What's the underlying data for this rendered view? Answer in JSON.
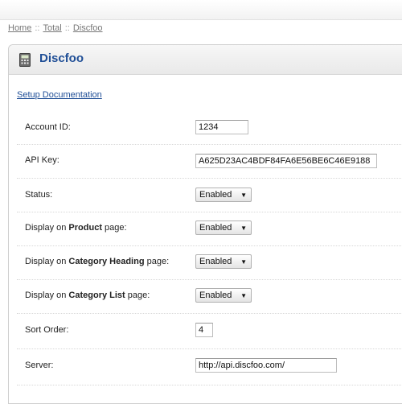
{
  "breadcrumb": {
    "home": "Home",
    "total": "Total",
    "current": "Discfoo",
    "separator": "::"
  },
  "panel": {
    "title": "Discfoo",
    "setup_link": "Setup Documentation"
  },
  "fields": {
    "account_id": {
      "label": "Account ID:",
      "value": "1234"
    },
    "api_key": {
      "label": "API Key:",
      "value": "A625D23AC4BDF84FA6E56BE6C46E9188"
    },
    "status": {
      "label": "Status:",
      "value": "Enabled"
    },
    "product_page": {
      "label_pre": "Display on ",
      "label_bold": "Product",
      "label_post": " page:",
      "value": "Enabled"
    },
    "category_heading": {
      "label_pre": "Display on ",
      "label_bold": "Category Heading",
      "label_post": " page:",
      "value": "Enabled"
    },
    "category_list": {
      "label_pre": "Display on ",
      "label_bold": "Category List",
      "label_post": " page:",
      "value": "Enabled"
    },
    "sort_order": {
      "label": "Sort Order:",
      "value": "4"
    },
    "server": {
      "label": "Server:",
      "value": "http://api.discfoo.com/"
    }
  },
  "icons": {
    "panel_icon": "calculator-icon",
    "select_arrow": "dropdown-arrow-icon"
  },
  "colors": {
    "title": "#1f4e96",
    "link": "#1f4e96",
    "breadcrumb": "#777777"
  }
}
